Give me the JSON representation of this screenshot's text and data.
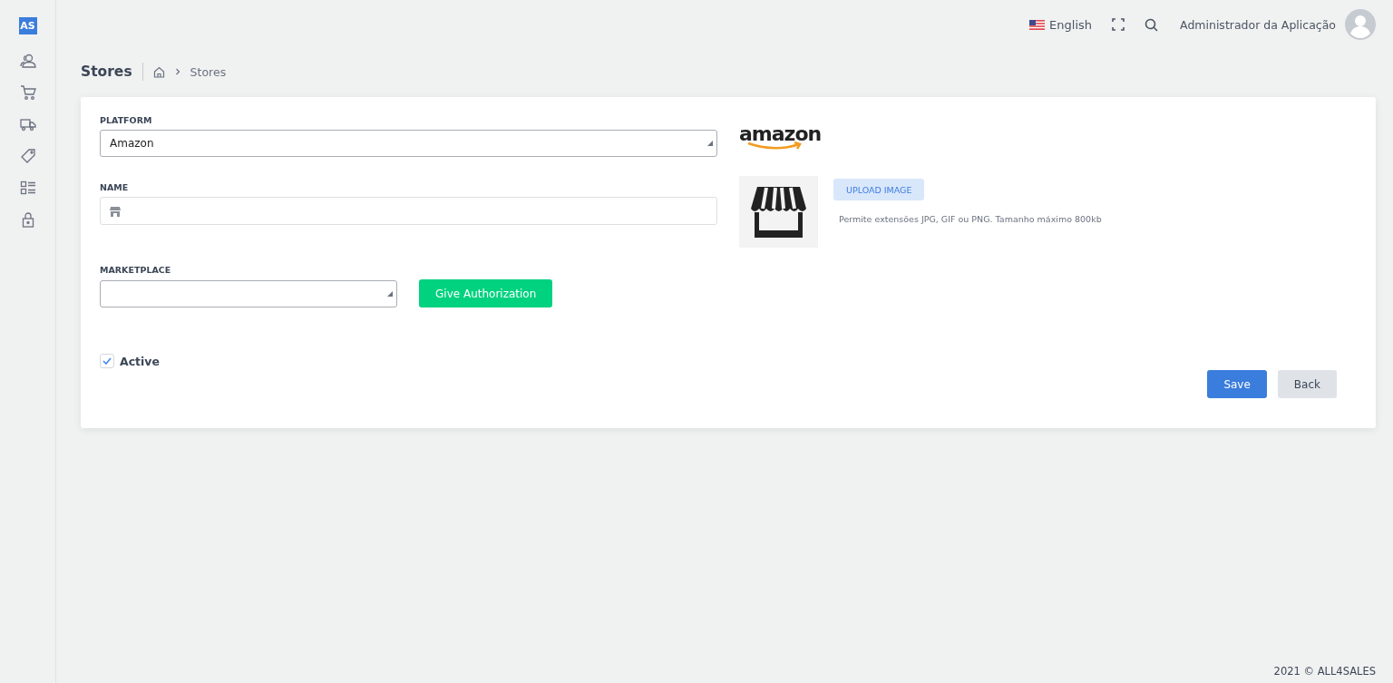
{
  "sidebar": {
    "logo": "AS",
    "items": [
      {
        "selected": false
      },
      {
        "selected": false
      },
      {
        "selected": false
      },
      {
        "selected": false
      },
      {
        "selected": false
      },
      {
        "selected": false
      }
    ]
  },
  "topbar": {
    "language": "English",
    "user": "Administrador da Aplicação"
  },
  "breadcrumb": {
    "title": "Stores",
    "current": "Stores"
  },
  "form": {
    "platform": {
      "label": "PLATFORM",
      "value": "Amazon"
    },
    "name": {
      "label": "NAME"
    },
    "marketplace": {
      "label": "MARKETPLACE"
    },
    "authorize_button": "Give Authorization",
    "active": {
      "label": "Active",
      "checked": true
    },
    "logo_text": "amazon",
    "upload_button": "UPLOAD IMAGE",
    "upload_hint": "Permite extensões JPG, GIF ou PNG. Tamanho máximo 800kb",
    "buttons": [
      {
        "label": "Save",
        "kind": "primary"
      },
      {
        "label": "Back",
        "kind": "secondary"
      }
    ]
  },
  "footer": "2021 © ALL4SALES"
}
